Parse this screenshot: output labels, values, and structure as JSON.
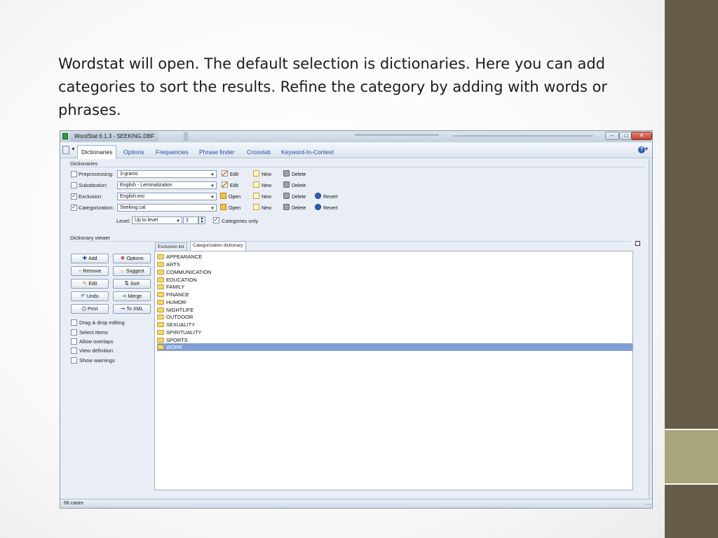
{
  "slide": {
    "text": "Wordstat will open. The default selection is dictionaries. Here you can add categories to sort the results. Refine the category by adding with words or phrases."
  },
  "window": {
    "title": "WordStat 6.1.3 - SEEKING.DBF",
    "tabs": [
      {
        "label": "Dictionaries",
        "active": true
      },
      {
        "label": "Options"
      },
      {
        "label": "Frequencies"
      },
      {
        "label": "Phrase finder"
      },
      {
        "label": "Crosstab"
      },
      {
        "label": "Keyword-In-Context"
      }
    ],
    "help_arrow": "▾",
    "dictionaries": {
      "group_label": "Dictionaries",
      "rows": [
        {
          "label": "Preprocessing:",
          "checked": false,
          "value": "3-grams",
          "actions": [
            "Edit",
            "New",
            "Delete"
          ]
        },
        {
          "label": "Substitution:",
          "checked": false,
          "value": "English - Lemmatization",
          "actions": [
            "Edit",
            "New",
            "Delete"
          ]
        },
        {
          "label": "Exclusion:",
          "checked": true,
          "value": "English.exc",
          "actions": [
            "Open",
            "New",
            "Delete",
            "Revert"
          ]
        },
        {
          "label": "Categorization:",
          "checked": true,
          "value": "Seeking.cat",
          "actions": [
            "Open",
            "New",
            "Delete",
            "Revert"
          ]
        }
      ],
      "level_label": "Level:",
      "level_value": "Up to level",
      "level_number": "1",
      "categories_only_label": "Categories only"
    },
    "viewer": {
      "group_label": "Dictionary viewer",
      "buttons": [
        [
          "Add",
          "Options"
        ],
        [
          "Remove",
          "Suggest"
        ],
        [
          "Edit",
          "Sort"
        ],
        [
          "Undo",
          "Merge"
        ],
        [
          "Print",
          "To XML"
        ]
      ],
      "checkboxes": [
        "Drag & drop editing",
        "Select items",
        "Allow overlaps",
        "View definition",
        "Show warnings"
      ],
      "tabs": [
        "Exclusion list",
        "Categorization dictionary"
      ],
      "categories": [
        "APPEARANCE",
        "ARTS",
        "COMMUNICATION",
        "EDUCATION",
        "FAMILY",
        "FINANCE",
        "HUMOR",
        "NIGHTLIFE",
        "OUTDOOR",
        "SEXUALITY",
        "SPIRITUALITY",
        "SPORTS",
        "WORK"
      ],
      "selected": "WORK"
    },
    "status": "68 cases"
  },
  "colors": {
    "side_bar": "#655d48",
    "side_accent": "#a8a57d",
    "selection": "#7f9fd4"
  }
}
